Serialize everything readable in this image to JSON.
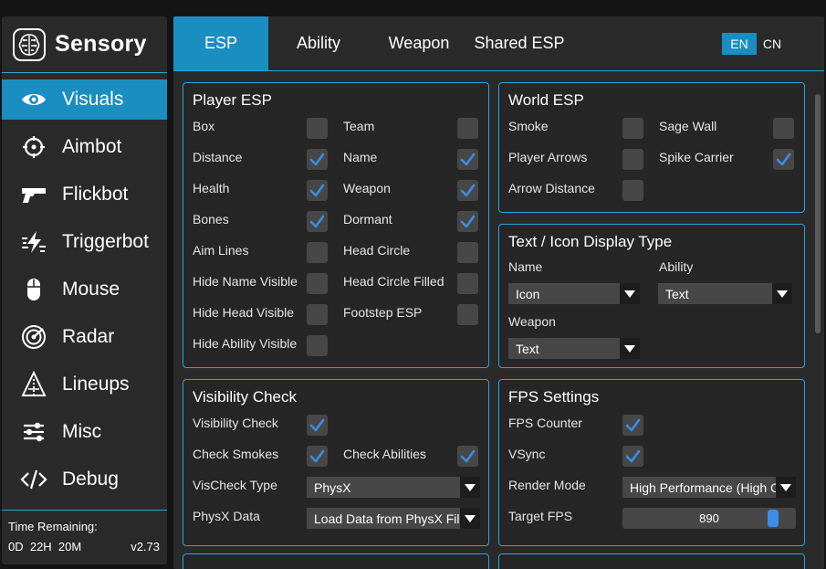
{
  "brand": {
    "name": "Sensory"
  },
  "sidebar": {
    "items": [
      {
        "label": "Visuals",
        "icon": "eye-icon",
        "active": true
      },
      {
        "label": "Aimbot",
        "icon": "crosshair-icon"
      },
      {
        "label": "Flickbot",
        "icon": "gun-icon"
      },
      {
        "label": "Triggerbot",
        "icon": "lightning-icon"
      },
      {
        "label": "Mouse",
        "icon": "mouse-icon"
      },
      {
        "label": "Radar",
        "icon": "radar-icon"
      },
      {
        "label": "Lineups",
        "icon": "tent-icon"
      },
      {
        "label": "Misc",
        "icon": "sliders-icon"
      },
      {
        "label": "Debug",
        "icon": "code-icon"
      }
    ],
    "footer": {
      "label": "Time Remaining:",
      "time": "0D  22H  20M",
      "version": "v2.73"
    }
  },
  "tabs": [
    "ESP",
    "Ability",
    "Weapon",
    "Shared ESP"
  ],
  "lang": {
    "en": "EN",
    "cn": "CN"
  },
  "panels": {
    "player_esp": {
      "title": "Player ESP",
      "left": [
        {
          "label": "Box",
          "checked": false
        },
        {
          "label": "Distance",
          "checked": true
        },
        {
          "label": "Health",
          "checked": true
        },
        {
          "label": "Bones",
          "checked": true
        },
        {
          "label": "Aim Lines",
          "checked": false
        },
        {
          "label": "Hide Name Visible",
          "checked": false
        },
        {
          "label": "Hide Head Visible",
          "checked": false
        },
        {
          "label": "Hide Ability Visible",
          "checked": false
        }
      ],
      "right": [
        {
          "label": "Team",
          "checked": false
        },
        {
          "label": "Name",
          "checked": true
        },
        {
          "label": "Weapon",
          "checked": true
        },
        {
          "label": "Dormant",
          "checked": true
        },
        {
          "label": "Head Circle",
          "checked": false
        },
        {
          "label": "Head Circle Filled",
          "checked": false
        },
        {
          "label": "Footstep ESP",
          "checked": false
        }
      ]
    },
    "world_esp": {
      "title": "World ESP",
      "left": [
        {
          "label": "Smoke",
          "checked": false
        },
        {
          "label": "Player Arrows",
          "checked": false
        },
        {
          "label": "Arrow Distance",
          "checked": false
        }
      ],
      "right": [
        {
          "label": "Sage Wall",
          "checked": false
        },
        {
          "label": "Spike Carrier",
          "checked": true
        }
      ]
    },
    "display_type": {
      "title": "Text / Icon Display Type",
      "name_label": "Name",
      "name_value": "Icon",
      "ability_label": "Ability",
      "ability_value": "Text",
      "weapon_label": "Weapon",
      "weapon_value": "Text"
    },
    "visibility": {
      "title": "Visibility Check",
      "vis_check": {
        "label": "Visibility Check",
        "checked": true
      },
      "check_smokes": {
        "label": "Check Smokes",
        "checked": true
      },
      "check_abilities": {
        "label": "Check Abilities",
        "checked": true
      },
      "vischeck_type_label": "VisCheck Type",
      "vischeck_type_value": "PhysX",
      "physx_data_label": "PhysX Data",
      "physx_data_value": "Load Data from PhysX File"
    },
    "fps": {
      "title": "FPS Settings",
      "fps_counter": {
        "label": "FPS Counter",
        "checked": true
      },
      "vsync": {
        "label": "VSync",
        "checked": true
      },
      "render_mode_label": "Render Mode",
      "render_mode_value": "High Performance (High CPU)",
      "target_fps_label": "Target FPS",
      "target_fps_value": "890",
      "target_fps_fraction": 0.9
    }
  },
  "colors": {
    "accent": "#1a8ec1",
    "border": "#2da2d4",
    "check": "#3b8de6"
  }
}
